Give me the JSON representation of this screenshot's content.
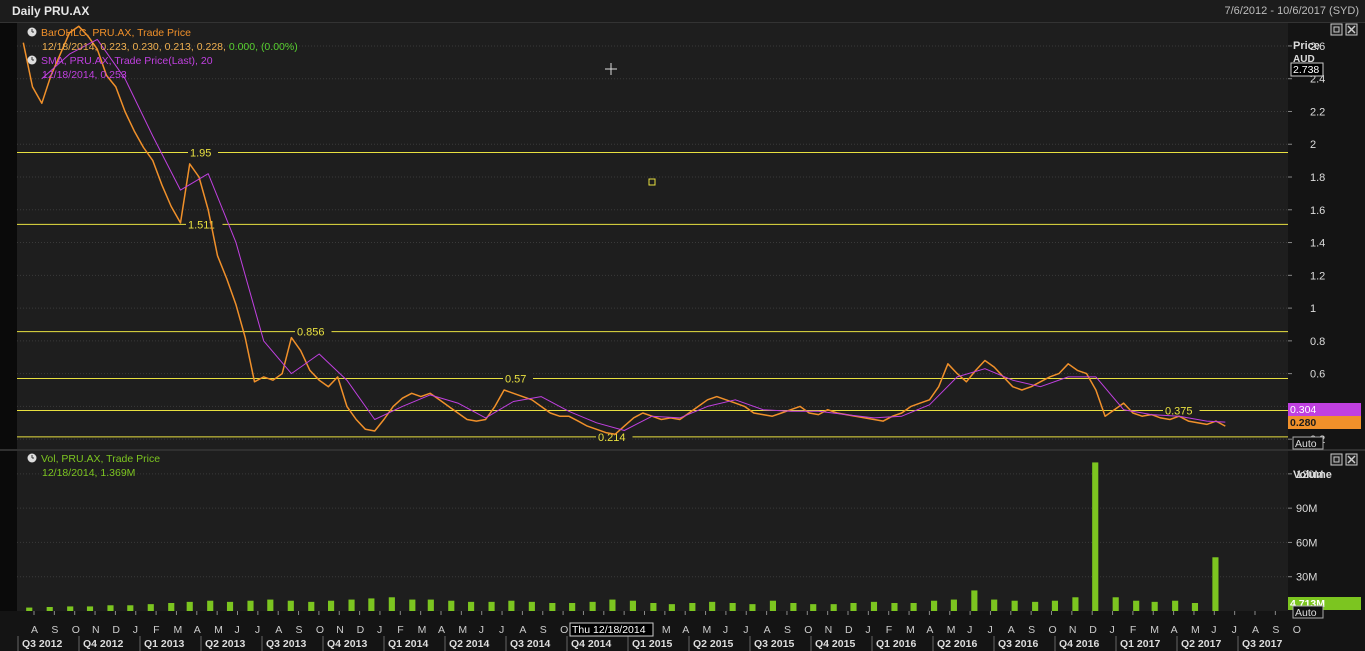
{
  "window": {
    "title": "Daily PRU.AX",
    "date_range": "7/6/2012 - 10/6/2017 (SYD)"
  },
  "colors": {
    "background": "#1e1e1e",
    "grid": "#3a3a3a",
    "price_line": "#f0902a",
    "sma_line": "#c040e0",
    "hline": "#e8e040",
    "volume": "#7cc520",
    "sma_badge": "#c040e0",
    "last_price_badge": "#f0902a",
    "volume_badge": "#7cc520"
  },
  "price_panel": {
    "legend": [
      {
        "icon": "clock-icon",
        "line1": "BarOHLC, PRU.AX, Trade Price",
        "line2": "12/18/2014, 0.223, 0.230, 0.213, 0.228, 0.000, (0.00%)",
        "color": "#f0902a",
        "line2_color": "#f0b050",
        "line2_tail": "0.000, (0.00%)",
        "tail_color": "#58d030"
      },
      {
        "icon": "clock-icon",
        "line1": "SMA, PRU.AX, Trade Price(Last),  20",
        "line2": "12/18/2014, 0.253",
        "color": "#c040e0",
        "line2_color": "#c040e0"
      }
    ],
    "axis_title": "Price",
    "axis_unit": "AUD",
    "current_value_box": "2.738",
    "y_ticks": [
      "2.6",
      "2.4",
      "2.2",
      "2",
      "1.8",
      "1.6",
      "1.4",
      "1.2",
      "1",
      "0.8",
      "0.6",
      "0.4",
      "0.2"
    ],
    "sma_badge": "0.304",
    "last_badge": "0.280",
    "auto_button": "Auto",
    "horizontal_lines": [
      {
        "value": 1.95,
        "label": "1.95"
      },
      {
        "value": 1.511,
        "label": "1.511"
      },
      {
        "value": 0.856,
        "label": "0.856"
      },
      {
        "value": 0.57,
        "label": "0.57"
      },
      {
        "value": 0.375,
        "label": "0.375"
      },
      {
        "value": 0.214,
        "label": "0.214"
      }
    ]
  },
  "volume_panel": {
    "legend": {
      "icon": "clock-icon",
      "line1": "Vol, PRU.AX, Trade Price",
      "line2": "12/18/2014, 1.369M"
    },
    "axis_title": "Volume",
    "y_ticks": [
      "120M",
      "90M",
      "60M",
      "30M"
    ],
    "last_badge": "4.713M",
    "auto_button": "Auto"
  },
  "x_axis": {
    "months": [
      "A",
      "S",
      "O",
      "N",
      "D",
      "J",
      "F",
      "M",
      "A",
      "M",
      "J",
      "J",
      "A",
      "S",
      "O",
      "N",
      "D",
      "J",
      "F",
      "M",
      "A",
      "M",
      "J",
      "J",
      "A",
      "S",
      "O",
      "N",
      "D",
      "J",
      "F",
      "M",
      "A",
      "M",
      "J",
      "J",
      "A",
      "S",
      "O",
      "N",
      "D",
      "J",
      "F",
      "M",
      "A",
      "M",
      "J",
      "J",
      "A",
      "S",
      "O",
      "N",
      "D",
      "J",
      "F",
      "M",
      "A",
      "M",
      "J",
      "J",
      "A",
      "S",
      "O"
    ],
    "quarters": [
      "Q3 2012",
      "Q4 2012",
      "Q1 2013",
      "Q2 2013",
      "Q3 2013",
      "Q4 2013",
      "Q1 2014",
      "Q2 2014",
      "Q3 2014",
      "Q4 2014",
      "Q1 2015",
      "Q2 2015",
      "Q3 2015",
      "Q4 2015",
      "Q1 2016",
      "Q2 2016",
      "Q3 2016",
      "Q4 2016",
      "Q1 2017",
      "Q2 2017",
      "Q3 2017"
    ],
    "cursor_label": "Thu 12/18/2014"
  },
  "chart_data": {
    "type": "line",
    "title": "Daily PRU.AX",
    "x_unit": "date",
    "ylabel": "Price AUD",
    "ylim": [
      0.14,
      2.74
    ],
    "series": [
      {
        "name": "BarOHLC, PRU.AX, Trade Price",
        "x": [
          "2012-07-06",
          "2012-07-20",
          "2012-08-03",
          "2012-08-17",
          "2012-08-31",
          "2012-09-14",
          "2012-09-28",
          "2012-10-12",
          "2012-10-26",
          "2012-11-09",
          "2012-11-23",
          "2012-12-07",
          "2012-12-21",
          "2013-01-04",
          "2013-01-18",
          "2013-02-01",
          "2013-02-15",
          "2013-03-01",
          "2013-03-15",
          "2013-03-29",
          "2013-04-12",
          "2013-04-26",
          "2013-05-10",
          "2013-05-24",
          "2013-06-07",
          "2013-06-21",
          "2013-07-05",
          "2013-07-19",
          "2013-08-02",
          "2013-08-16",
          "2013-08-30",
          "2013-09-13",
          "2013-09-27",
          "2013-10-11",
          "2013-10-25",
          "2013-11-08",
          "2013-11-22",
          "2013-12-06",
          "2013-12-20",
          "2014-01-03",
          "2014-01-17",
          "2014-01-31",
          "2014-02-14",
          "2014-02-28",
          "2014-03-14",
          "2014-03-28",
          "2014-04-11",
          "2014-04-25",
          "2014-05-09",
          "2014-05-23",
          "2014-06-06",
          "2014-06-20",
          "2014-07-04",
          "2014-07-18",
          "2014-08-01",
          "2014-08-15",
          "2014-08-29",
          "2014-09-12",
          "2014-09-26",
          "2014-10-10",
          "2014-10-24",
          "2014-11-07",
          "2014-11-21",
          "2014-12-05",
          "2014-12-19",
          "2015-01-02",
          "2015-01-16",
          "2015-01-30",
          "2015-02-13",
          "2015-02-27",
          "2015-03-13",
          "2015-03-27",
          "2015-04-10",
          "2015-04-24",
          "2015-05-08",
          "2015-05-22",
          "2015-06-05",
          "2015-06-19",
          "2015-07-03",
          "2015-07-17",
          "2015-07-31",
          "2015-08-14",
          "2015-08-28",
          "2015-09-11",
          "2015-09-25",
          "2015-10-09",
          "2015-10-23",
          "2015-11-06",
          "2015-11-20",
          "2015-12-04",
          "2015-12-18",
          "2016-01-01",
          "2016-01-15",
          "2016-01-29",
          "2016-02-12",
          "2016-02-26",
          "2016-03-11",
          "2016-03-25",
          "2016-04-08",
          "2016-04-22",
          "2016-05-06",
          "2016-05-20",
          "2016-06-03",
          "2016-06-17",
          "2016-07-01",
          "2016-07-15",
          "2016-07-29",
          "2016-08-12",
          "2016-08-26",
          "2016-09-09",
          "2016-09-23",
          "2016-10-07",
          "2016-10-21",
          "2016-11-04",
          "2016-11-18",
          "2016-12-02",
          "2016-12-16",
          "2016-12-30",
          "2017-01-13",
          "2017-01-27",
          "2017-02-10",
          "2017-02-24",
          "2017-03-10",
          "2017-03-24",
          "2017-04-07",
          "2017-04-21",
          "2017-05-05",
          "2017-05-19",
          "2017-06-02",
          "2017-06-16",
          "2017-06-30"
        ],
        "values": [
          2.62,
          2.35,
          2.25,
          2.42,
          2.55,
          2.68,
          2.72,
          2.66,
          2.58,
          2.42,
          2.35,
          2.2,
          2.08,
          1.98,
          1.9,
          1.75,
          1.62,
          1.52,
          1.88,
          1.8,
          1.6,
          1.32,
          1.18,
          1.02,
          0.82,
          0.55,
          0.58,
          0.56,
          0.6,
          0.82,
          0.74,
          0.62,
          0.56,
          0.52,
          0.58,
          0.4,
          0.32,
          0.26,
          0.25,
          0.32,
          0.4,
          0.45,
          0.48,
          0.46,
          0.48,
          0.44,
          0.4,
          0.36,
          0.32,
          0.31,
          0.32,
          0.4,
          0.5,
          0.48,
          0.46,
          0.44,
          0.4,
          0.36,
          0.34,
          0.34,
          0.31,
          0.28,
          0.26,
          0.24,
          0.23,
          0.28,
          0.33,
          0.36,
          0.34,
          0.32,
          0.33,
          0.32,
          0.36,
          0.4,
          0.44,
          0.46,
          0.44,
          0.42,
          0.4,
          0.36,
          0.35,
          0.34,
          0.36,
          0.38,
          0.4,
          0.36,
          0.35,
          0.38,
          0.36,
          0.35,
          0.34,
          0.33,
          0.32,
          0.31,
          0.34,
          0.36,
          0.4,
          0.42,
          0.44,
          0.52,
          0.66,
          0.6,
          0.55,
          0.62,
          0.68,
          0.64,
          0.58,
          0.52,
          0.5,
          0.52,
          0.55,
          0.58,
          0.6,
          0.66,
          0.62,
          0.6,
          0.5,
          0.34,
          0.38,
          0.42,
          0.36,
          0.34,
          0.35,
          0.33,
          0.32,
          0.34,
          0.31,
          0.3,
          0.29,
          0.31,
          0.28
        ]
      },
      {
        "name": "SMA, PRU.AX, Trade Price(Last),  20",
        "x": [
          "2012-08-03",
          "2012-09-14",
          "2012-10-26",
          "2012-12-07",
          "2013-01-18",
          "2013-03-01",
          "2013-04-12",
          "2013-05-24",
          "2013-07-05",
          "2013-08-16",
          "2013-09-27",
          "2013-11-08",
          "2013-12-20",
          "2014-01-31",
          "2014-03-14",
          "2014-04-25",
          "2014-06-06",
          "2014-07-18",
          "2014-08-29",
          "2014-10-10",
          "2014-11-21",
          "2015-01-02",
          "2015-02-13",
          "2015-03-27",
          "2015-05-08",
          "2015-06-19",
          "2015-07-31",
          "2015-09-11",
          "2015-10-23",
          "2015-12-04",
          "2016-01-15",
          "2016-02-26",
          "2016-04-08",
          "2016-05-20",
          "2016-07-01",
          "2016-08-12",
          "2016-09-23",
          "2016-11-04",
          "2016-12-16",
          "2017-01-27",
          "2017-03-10",
          "2017-04-21",
          "2017-06-02",
          "2017-06-30"
        ],
        "values": [
          2.4,
          2.55,
          2.64,
          2.4,
          2.05,
          1.72,
          1.82,
          1.4,
          0.8,
          0.6,
          0.72,
          0.56,
          0.32,
          0.4,
          0.47,
          0.42,
          0.33,
          0.43,
          0.46,
          0.37,
          0.3,
          0.253,
          0.34,
          0.33,
          0.4,
          0.44,
          0.38,
          0.37,
          0.37,
          0.35,
          0.33,
          0.34,
          0.41,
          0.58,
          0.63,
          0.56,
          0.52,
          0.58,
          0.58,
          0.38,
          0.35,
          0.34,
          0.31,
          0.304
        ]
      }
    ],
    "volume": {
      "name": "Vol, PRU.AX, Trade Price",
      "ylabel": "Volume",
      "ylim": [
        0,
        140000000
      ],
      "x": [
        "2012-07",
        "2012-08",
        "2012-09",
        "2012-10",
        "2012-11",
        "2012-12",
        "2013-01",
        "2013-02",
        "2013-03",
        "2013-04",
        "2013-05",
        "2013-06",
        "2013-07",
        "2013-08",
        "2013-09",
        "2013-10",
        "2013-11",
        "2013-12",
        "2014-01",
        "2014-02",
        "2014-03",
        "2014-04",
        "2014-05",
        "2014-06",
        "2014-07",
        "2014-08",
        "2014-09",
        "2014-10",
        "2014-11",
        "2014-12",
        "2015-01",
        "2015-02",
        "2015-03",
        "2015-04",
        "2015-05",
        "2015-06",
        "2015-07",
        "2015-08",
        "2015-09",
        "2015-10",
        "2015-11",
        "2015-12",
        "2016-01",
        "2016-02",
        "2016-03",
        "2016-04",
        "2016-05",
        "2016-06",
        "2016-07",
        "2016-08",
        "2016-09",
        "2016-10",
        "2016-11",
        "2016-12",
        "2017-01",
        "2017-02",
        "2017-03",
        "2017-04",
        "2017-05",
        "2017-06"
      ],
      "values": [
        3000000,
        3500000,
        4000000,
        4000000,
        5000000,
        5000000,
        6000000,
        7000000,
        8000000,
        9000000,
        8000000,
        9000000,
        10000000,
        9000000,
        8000000,
        9000000,
        10000000,
        11000000,
        12000000,
        10000000,
        10000000,
        9000000,
        8000000,
        8000000,
        9000000,
        8000000,
        7000000,
        7000000,
        8000000,
        10000000,
        9000000,
        7000000,
        6000000,
        7000000,
        8000000,
        7000000,
        6000000,
        9000000,
        7000000,
        6000000,
        6000000,
        7000000,
        8000000,
        7000000,
        7000000,
        9000000,
        10000000,
        18000000,
        10000000,
        9000000,
        8000000,
        9000000,
        12000000,
        130000000,
        12000000,
        9000000,
        8000000,
        9000000,
        7000000,
        47000000
      ],
      "last": "4.713M"
    }
  }
}
